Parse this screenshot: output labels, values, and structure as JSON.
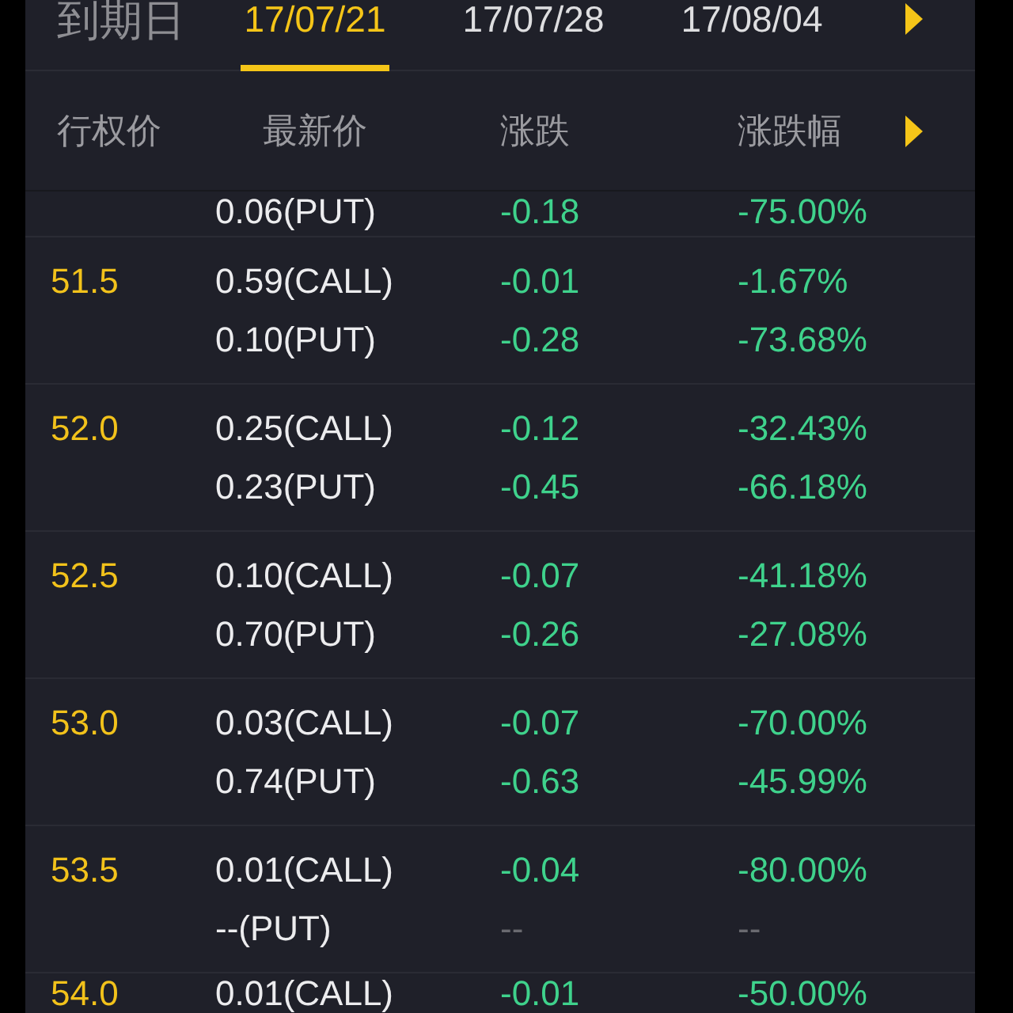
{
  "expiry_bar": {
    "label": "到期日",
    "dates": [
      {
        "label": "17/07/21",
        "selected": true
      },
      {
        "label": "17/07/28",
        "selected": false
      },
      {
        "label": "17/08/04",
        "selected": false
      }
    ]
  },
  "table": {
    "columns": [
      "行权价",
      "最新价",
      "涨跌",
      "涨跌幅"
    ],
    "rows": [
      {
        "options": [
          {
            "price": "0.06(PUT)",
            "change": "-0.18",
            "change_pct": "-75.00%",
            "has_quote": true
          }
        ]
      },
      {
        "strike": "51.5",
        "options": [
          {
            "price": "0.59(CALL)",
            "change": "-0.01",
            "change_pct": "-1.67%",
            "has_quote": true
          },
          {
            "price": "0.10(PUT)",
            "change": "-0.28",
            "change_pct": "-73.68%",
            "has_quote": true
          }
        ]
      },
      {
        "strike": "52.0",
        "options": [
          {
            "price": "0.25(CALL)",
            "change": "-0.12",
            "change_pct": "-32.43%",
            "has_quote": true
          },
          {
            "price": "0.23(PUT)",
            "change": "-0.45",
            "change_pct": "-66.18%",
            "has_quote": true
          }
        ]
      },
      {
        "strike": "52.5",
        "options": [
          {
            "price": "0.10(CALL)",
            "change": "-0.07",
            "change_pct": "-41.18%",
            "has_quote": true
          },
          {
            "price": "0.70(PUT)",
            "change": "-0.26",
            "change_pct": "-27.08%",
            "has_quote": true
          }
        ]
      },
      {
        "strike": "53.0",
        "options": [
          {
            "price": "0.03(CALL)",
            "change": "-0.07",
            "change_pct": "-70.00%",
            "has_quote": true
          },
          {
            "price": "0.74(PUT)",
            "change": "-0.63",
            "change_pct": "-45.99%",
            "has_quote": true
          }
        ]
      },
      {
        "strike": "53.5",
        "options": [
          {
            "price": "0.01(CALL)",
            "change": "-0.04",
            "change_pct": "-80.00%",
            "has_quote": true
          },
          {
            "price": "--(PUT)",
            "change": "--",
            "change_pct": "--",
            "has_quote": false
          }
        ]
      },
      {
        "strike": "54.0",
        "options": [
          {
            "price": "0.01(CALL)",
            "change": "-0.01",
            "change_pct": "-50.00%",
            "has_quote": true
          }
        ]
      }
    ]
  }
}
